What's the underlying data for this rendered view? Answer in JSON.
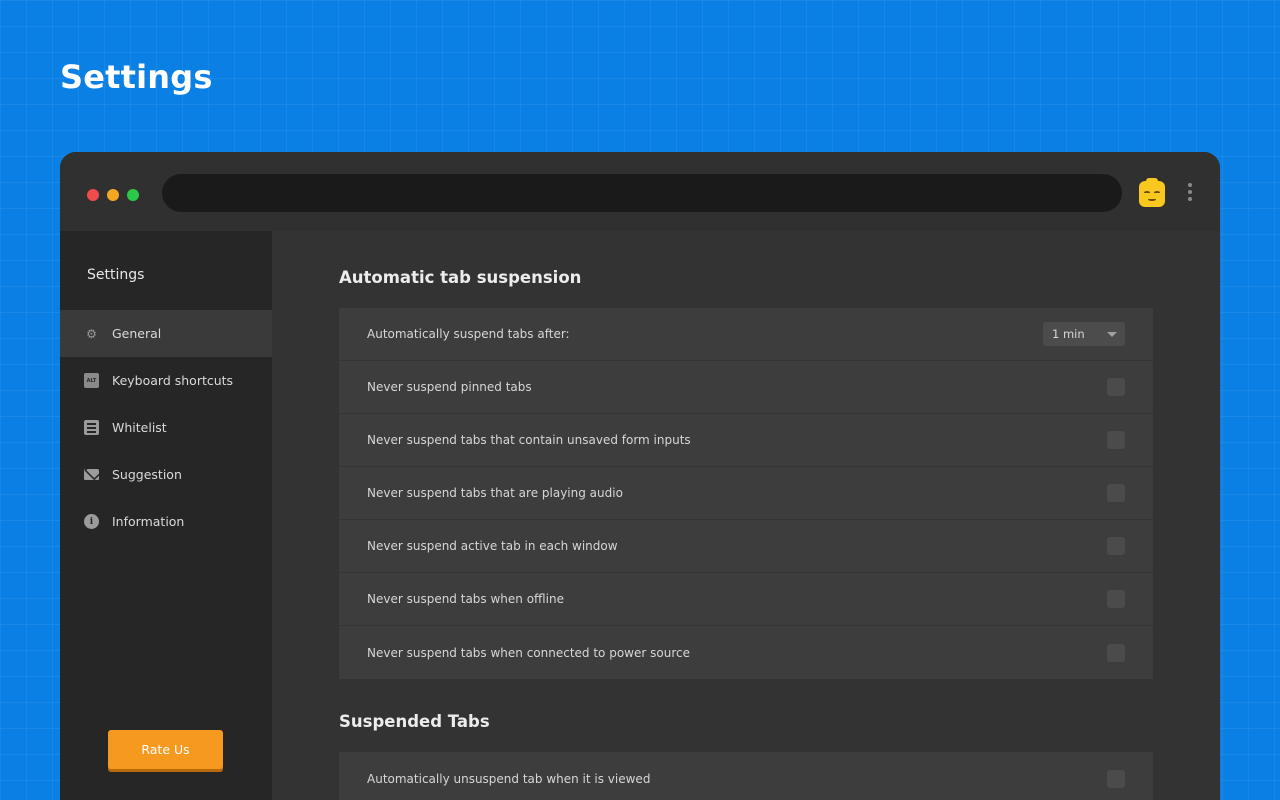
{
  "page": {
    "title": "Settings"
  },
  "window": {
    "traffic_lights": [
      "red",
      "yellow",
      "green"
    ],
    "extension_icon": "face-emoji-icon",
    "menu_icon": "kebab-menu-icon"
  },
  "sidebar": {
    "header": "Settings",
    "items": [
      {
        "label": "General",
        "icon": "gear-icon",
        "active": true
      },
      {
        "label": "Keyboard shortcuts",
        "icon": "alt-key-icon",
        "active": false
      },
      {
        "label": "Whitelist",
        "icon": "list-icon",
        "active": false
      },
      {
        "label": "Suggestion",
        "icon": "envelope-icon",
        "active": false
      },
      {
        "label": "Information",
        "icon": "info-icon",
        "active": false
      }
    ],
    "rate_button": "Rate Us"
  },
  "sections": [
    {
      "title": "Automatic tab suspension",
      "rows": [
        {
          "label": "Automatically suspend tabs after:",
          "control": "select",
          "value": "1 min"
        },
        {
          "label": "Never suspend pinned tabs",
          "control": "checkbox",
          "checked": false
        },
        {
          "label": "Never suspend tabs that contain unsaved form inputs",
          "control": "checkbox",
          "checked": false
        },
        {
          "label": "Never suspend tabs that are playing audio",
          "control": "checkbox",
          "checked": false
        },
        {
          "label": "Never suspend active tab in each window",
          "control": "checkbox",
          "checked": false
        },
        {
          "label": "Never suspend tabs when offline",
          "control": "checkbox",
          "checked": false
        },
        {
          "label": "Never suspend tabs when connected to power source",
          "control": "checkbox",
          "checked": false
        }
      ]
    },
    {
      "title": "Suspended Tabs",
      "rows": [
        {
          "label": "Automatically unsuspend tab when it is viewed",
          "control": "checkbox",
          "checked": false
        }
      ]
    }
  ],
  "colors": {
    "background": "#0a7fe4",
    "accent": "#f59a1e",
    "window": "#333333",
    "sidebar": "#262626"
  }
}
